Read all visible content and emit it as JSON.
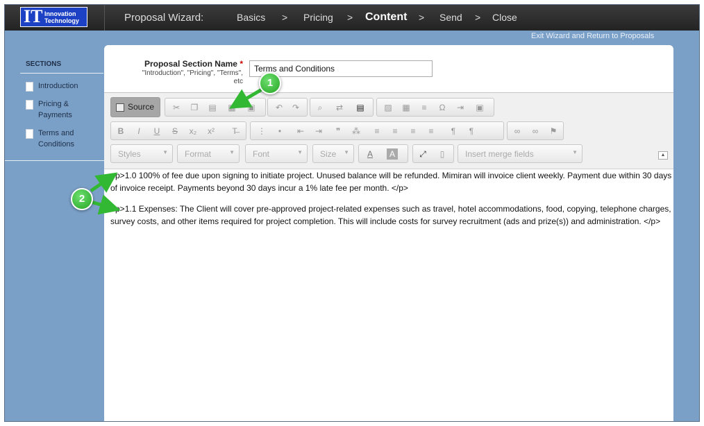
{
  "header": {
    "logo_mark": "IT",
    "logo_name_line1": "Innovation",
    "logo_name_line2": "Technology",
    "wizard_title": "Proposal Wizard:",
    "steps": [
      {
        "label": "Basics"
      },
      {
        "label": "Pricing"
      },
      {
        "label": "Content"
      },
      {
        "label": "Send"
      },
      {
        "label": "Close"
      }
    ],
    "separator": ">",
    "active_step": "Content",
    "exit_link": "Exit Wizard and Return to Proposals"
  },
  "sidebar": {
    "heading": "SECTIONS",
    "items": [
      {
        "label": "Introduction"
      },
      {
        "label": "Pricing & Payments"
      },
      {
        "label": "Terms and Conditions"
      }
    ]
  },
  "form": {
    "section_name_label": "Proposal Section Name",
    "required_mark": "*",
    "hint": "\"Introduction\", \"Pricing\", \"Terms\", etc",
    "section_name_value": "Terms and Conditions"
  },
  "editor": {
    "source_button": "Source",
    "styles_combo": "Styles",
    "format_combo": "Format",
    "font_combo": "Font",
    "size_combo": "Size",
    "merge_fields_combo": "Insert merge fields",
    "paragraphs": [
      "<p>1.0 100% of fee due upon signing to initiate project.  Unused balance will be refunded.  Mimiran will invoice client weekly.  Payment due within 30 days of invoice receipt. Payments beyond 30 days incur a 1% late fee per month. </p>",
      "<p>1.1 Expenses:  The Client will cover pre-approved project-related expenses such as travel, hotel accommodations, food, copying, telephone charges, survey costs, and other items required for project completion.  This will include costs for survey recruitment (ads and prize(s)) and administration.   </p>"
    ]
  },
  "annotations": [
    {
      "label": "1"
    },
    {
      "label": "2"
    }
  ],
  "colors": {
    "background": "#7ba0c8",
    "topbar": "#2e2e2e",
    "logo": "#1d41c4",
    "badge": "#34b834"
  }
}
